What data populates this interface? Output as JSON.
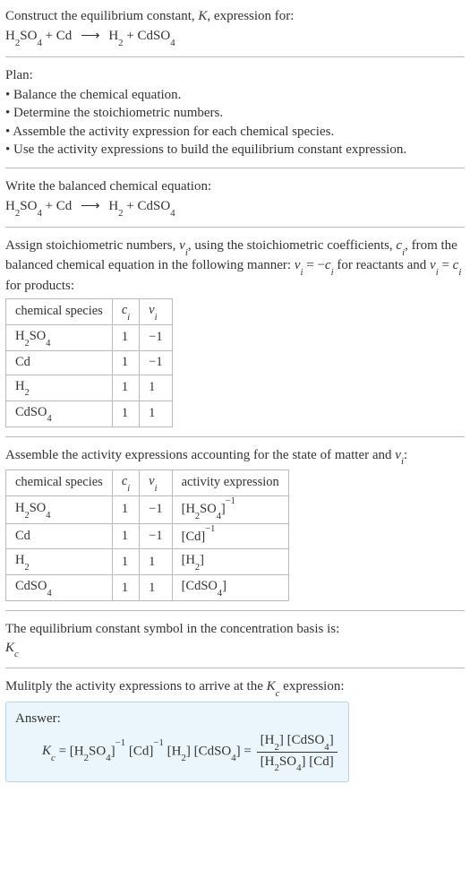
{
  "title_line1": "Construct the equilibrium constant, K, expression for:",
  "title_eq": "H₂SO₄ + Cd ⟶ H₂ + CdSO₄",
  "plan_label": "Plan:",
  "plan_items": [
    "Balance the chemical equation.",
    "Determine the stoichiometric numbers.",
    "Assemble the activity expression for each chemical species.",
    "Use the activity expressions to build the equilibrium constant expression."
  ],
  "balanced_label": "Write the balanced chemical equation:",
  "balanced_eq": "H₂SO₄ + Cd ⟶ H₂ + CdSO₄",
  "assign_text_1": "Assign stoichiometric numbers, νᵢ, using the stoichiometric coefficients, cᵢ, from the balanced chemical equation in the following manner: νᵢ = −cᵢ for reactants and νᵢ = cᵢ for products:",
  "table1": {
    "headers": [
      "chemical species",
      "cᵢ",
      "νᵢ"
    ],
    "rows": [
      [
        "H₂SO₄",
        "1",
        "−1"
      ],
      [
        "Cd",
        "1",
        "−1"
      ],
      [
        "H₂",
        "1",
        "1"
      ],
      [
        "CdSO₄",
        "1",
        "1"
      ]
    ]
  },
  "assemble_text": "Assemble the activity expressions accounting for the state of matter and νᵢ:",
  "table2": {
    "headers": [
      "chemical species",
      "cᵢ",
      "νᵢ",
      "activity expression"
    ],
    "rows": [
      [
        "H₂SO₄",
        "1",
        "−1",
        "[H₂SO₄]⁻¹"
      ],
      [
        "Cd",
        "1",
        "−1",
        "[Cd]⁻¹"
      ],
      [
        "H₂",
        "1",
        "1",
        "[H₂]"
      ],
      [
        "CdSO₄",
        "1",
        "1",
        "[CdSO₄]"
      ]
    ]
  },
  "symbol_text": "The equilibrium constant symbol in the concentration basis is:",
  "symbol_value": "K_c",
  "multiply_text": "Mulitply the activity expressions to arrive at the K_c expression:",
  "answer_label": "Answer:",
  "answer": {
    "lhs": "K_c",
    "product_terms": "[H₂SO₄]⁻¹ [Cd]⁻¹ [H₂] [CdSO₄]",
    "frac_num": "[H₂] [CdSO₄]",
    "frac_den": "[H₂SO₄] [Cd]"
  },
  "chart_data": {
    "type": "table",
    "tables": [
      {
        "title": "stoichiometric numbers",
        "columns": [
          "chemical species",
          "c_i",
          "nu_i"
        ],
        "rows": [
          {
            "chemical species": "H2SO4",
            "c_i": 1,
            "nu_i": -1
          },
          {
            "chemical species": "Cd",
            "c_i": 1,
            "nu_i": -1
          },
          {
            "chemical species": "H2",
            "c_i": 1,
            "nu_i": 1
          },
          {
            "chemical species": "CdSO4",
            "c_i": 1,
            "nu_i": 1
          }
        ]
      },
      {
        "title": "activity expressions",
        "columns": [
          "chemical species",
          "c_i",
          "nu_i",
          "activity expression"
        ],
        "rows": [
          {
            "chemical species": "H2SO4",
            "c_i": 1,
            "nu_i": -1,
            "activity expression": "[H2SO4]^-1"
          },
          {
            "chemical species": "Cd",
            "c_i": 1,
            "nu_i": -1,
            "activity expression": "[Cd]^-1"
          },
          {
            "chemical species": "H2",
            "c_i": 1,
            "nu_i": 1,
            "activity expression": "[H2]"
          },
          {
            "chemical species": "CdSO4",
            "c_i": 1,
            "nu_i": 1,
            "activity expression": "[CdSO4]"
          }
        ]
      }
    ]
  }
}
